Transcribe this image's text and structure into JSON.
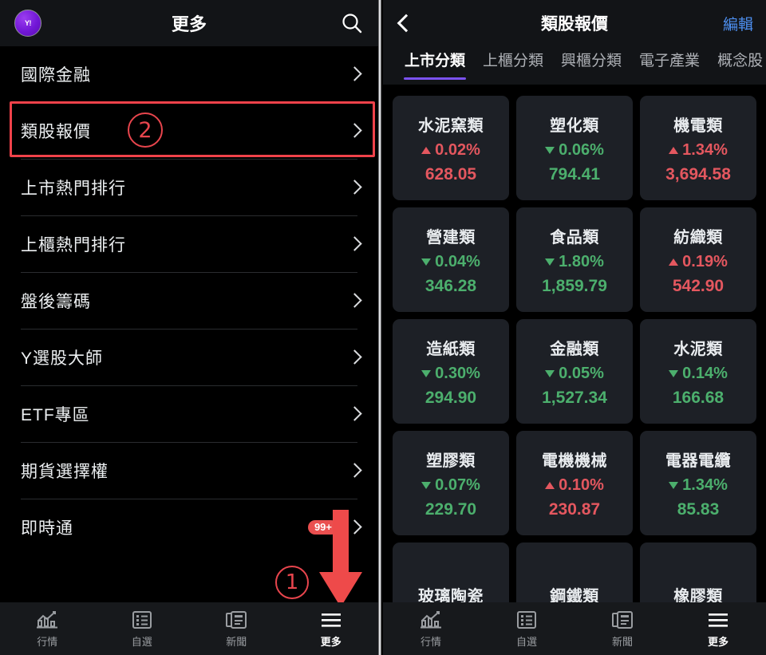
{
  "left_panel": {
    "header": {
      "avatar_label": "Y!",
      "avatar_icon": "yahoo-avatar",
      "title": "更多",
      "search_icon": "search-icon"
    },
    "menu_items": [
      {
        "label": "國際金融",
        "chevron_icon": "chevron-right-icon",
        "badge": ""
      },
      {
        "label": "類股報價",
        "chevron_icon": "chevron-right-icon",
        "badge": ""
      },
      {
        "label": "上市熱門排行",
        "chevron_icon": "chevron-right-icon",
        "badge": ""
      },
      {
        "label": "上櫃熱門排行",
        "chevron_icon": "chevron-right-icon",
        "badge": ""
      },
      {
        "label": "盤後籌碼",
        "chevron_icon": "chevron-right-icon",
        "badge": ""
      },
      {
        "label": "Y選股大師",
        "chevron_icon": "chevron-right-icon",
        "badge": ""
      },
      {
        "label": "ETF專區",
        "chevron_icon": "chevron-right-icon",
        "badge": ""
      },
      {
        "label": "期貨選擇權",
        "chevron_icon": "chevron-right-icon",
        "badge": ""
      },
      {
        "label": "即時通",
        "chevron_icon": "chevron-right-icon",
        "badge": "99+"
      }
    ],
    "tabbar": [
      {
        "label": "行情",
        "icon": "chart-icon",
        "active": false
      },
      {
        "label": "自選",
        "icon": "list-icon",
        "active": false
      },
      {
        "label": "新聞",
        "icon": "news-icon",
        "active": false
      },
      {
        "label": "更多",
        "icon": "hamburger-icon",
        "active": true
      }
    ]
  },
  "annotations": {
    "step1": "1",
    "step2": "2",
    "highlight_color": "#f0424a",
    "arrow_color": "#ee4a4a"
  },
  "right_panel": {
    "header": {
      "back_icon": "back-chevron-icon",
      "title": "類股報價",
      "edit_label": "編輯"
    },
    "tabs": [
      {
        "label": "上市分類",
        "active": true
      },
      {
        "label": "上櫃分類",
        "active": false
      },
      {
        "label": "興櫃分類",
        "active": false
      },
      {
        "label": "電子產業",
        "active": false
      },
      {
        "label": "概念股",
        "active": false
      }
    ],
    "active_tab_underline_color": "#7b52f0",
    "up_color": "#e4575f",
    "down_color": "#4caf6d",
    "tiles": [
      {
        "name": "水泥窯類",
        "direction": "up",
        "percent": "0.02%",
        "value": "628.05"
      },
      {
        "name": "塑化類",
        "direction": "down",
        "percent": "0.06%",
        "value": "794.41"
      },
      {
        "name": "機電類",
        "direction": "up",
        "percent": "1.34%",
        "value": "3,694.58"
      },
      {
        "name": "營建類",
        "direction": "down",
        "percent": "0.04%",
        "value": "346.28"
      },
      {
        "name": "食品類",
        "direction": "down",
        "percent": "1.80%",
        "value": "1,859.79"
      },
      {
        "name": "紡織類",
        "direction": "up",
        "percent": "0.19%",
        "value": "542.90"
      },
      {
        "name": "造紙類",
        "direction": "down",
        "percent": "0.30%",
        "value": "294.90"
      },
      {
        "name": "金融類",
        "direction": "down",
        "percent": "0.05%",
        "value": "1,527.34"
      },
      {
        "name": "水泥類",
        "direction": "down",
        "percent": "0.14%",
        "value": "166.68"
      },
      {
        "name": "塑膠類",
        "direction": "down",
        "percent": "0.07%",
        "value": "229.70"
      },
      {
        "name": "電機機械",
        "direction": "up",
        "percent": "0.10%",
        "value": "230.87"
      },
      {
        "name": "電器電纜",
        "direction": "down",
        "percent": "1.34%",
        "value": "85.83"
      },
      {
        "name": "玻璃陶瓷",
        "direction": "down",
        "percent": "",
        "value": ""
      },
      {
        "name": "鋼鐵類",
        "direction": "down",
        "percent": "",
        "value": ""
      },
      {
        "name": "橡膠類",
        "direction": "down",
        "percent": "",
        "value": ""
      }
    ],
    "tabbar": [
      {
        "label": "行情",
        "icon": "chart-icon",
        "active": false
      },
      {
        "label": "自選",
        "icon": "list-icon",
        "active": false
      },
      {
        "label": "新聞",
        "icon": "news-icon",
        "active": false
      },
      {
        "label": "更多",
        "icon": "hamburger-icon",
        "active": true
      }
    ]
  }
}
